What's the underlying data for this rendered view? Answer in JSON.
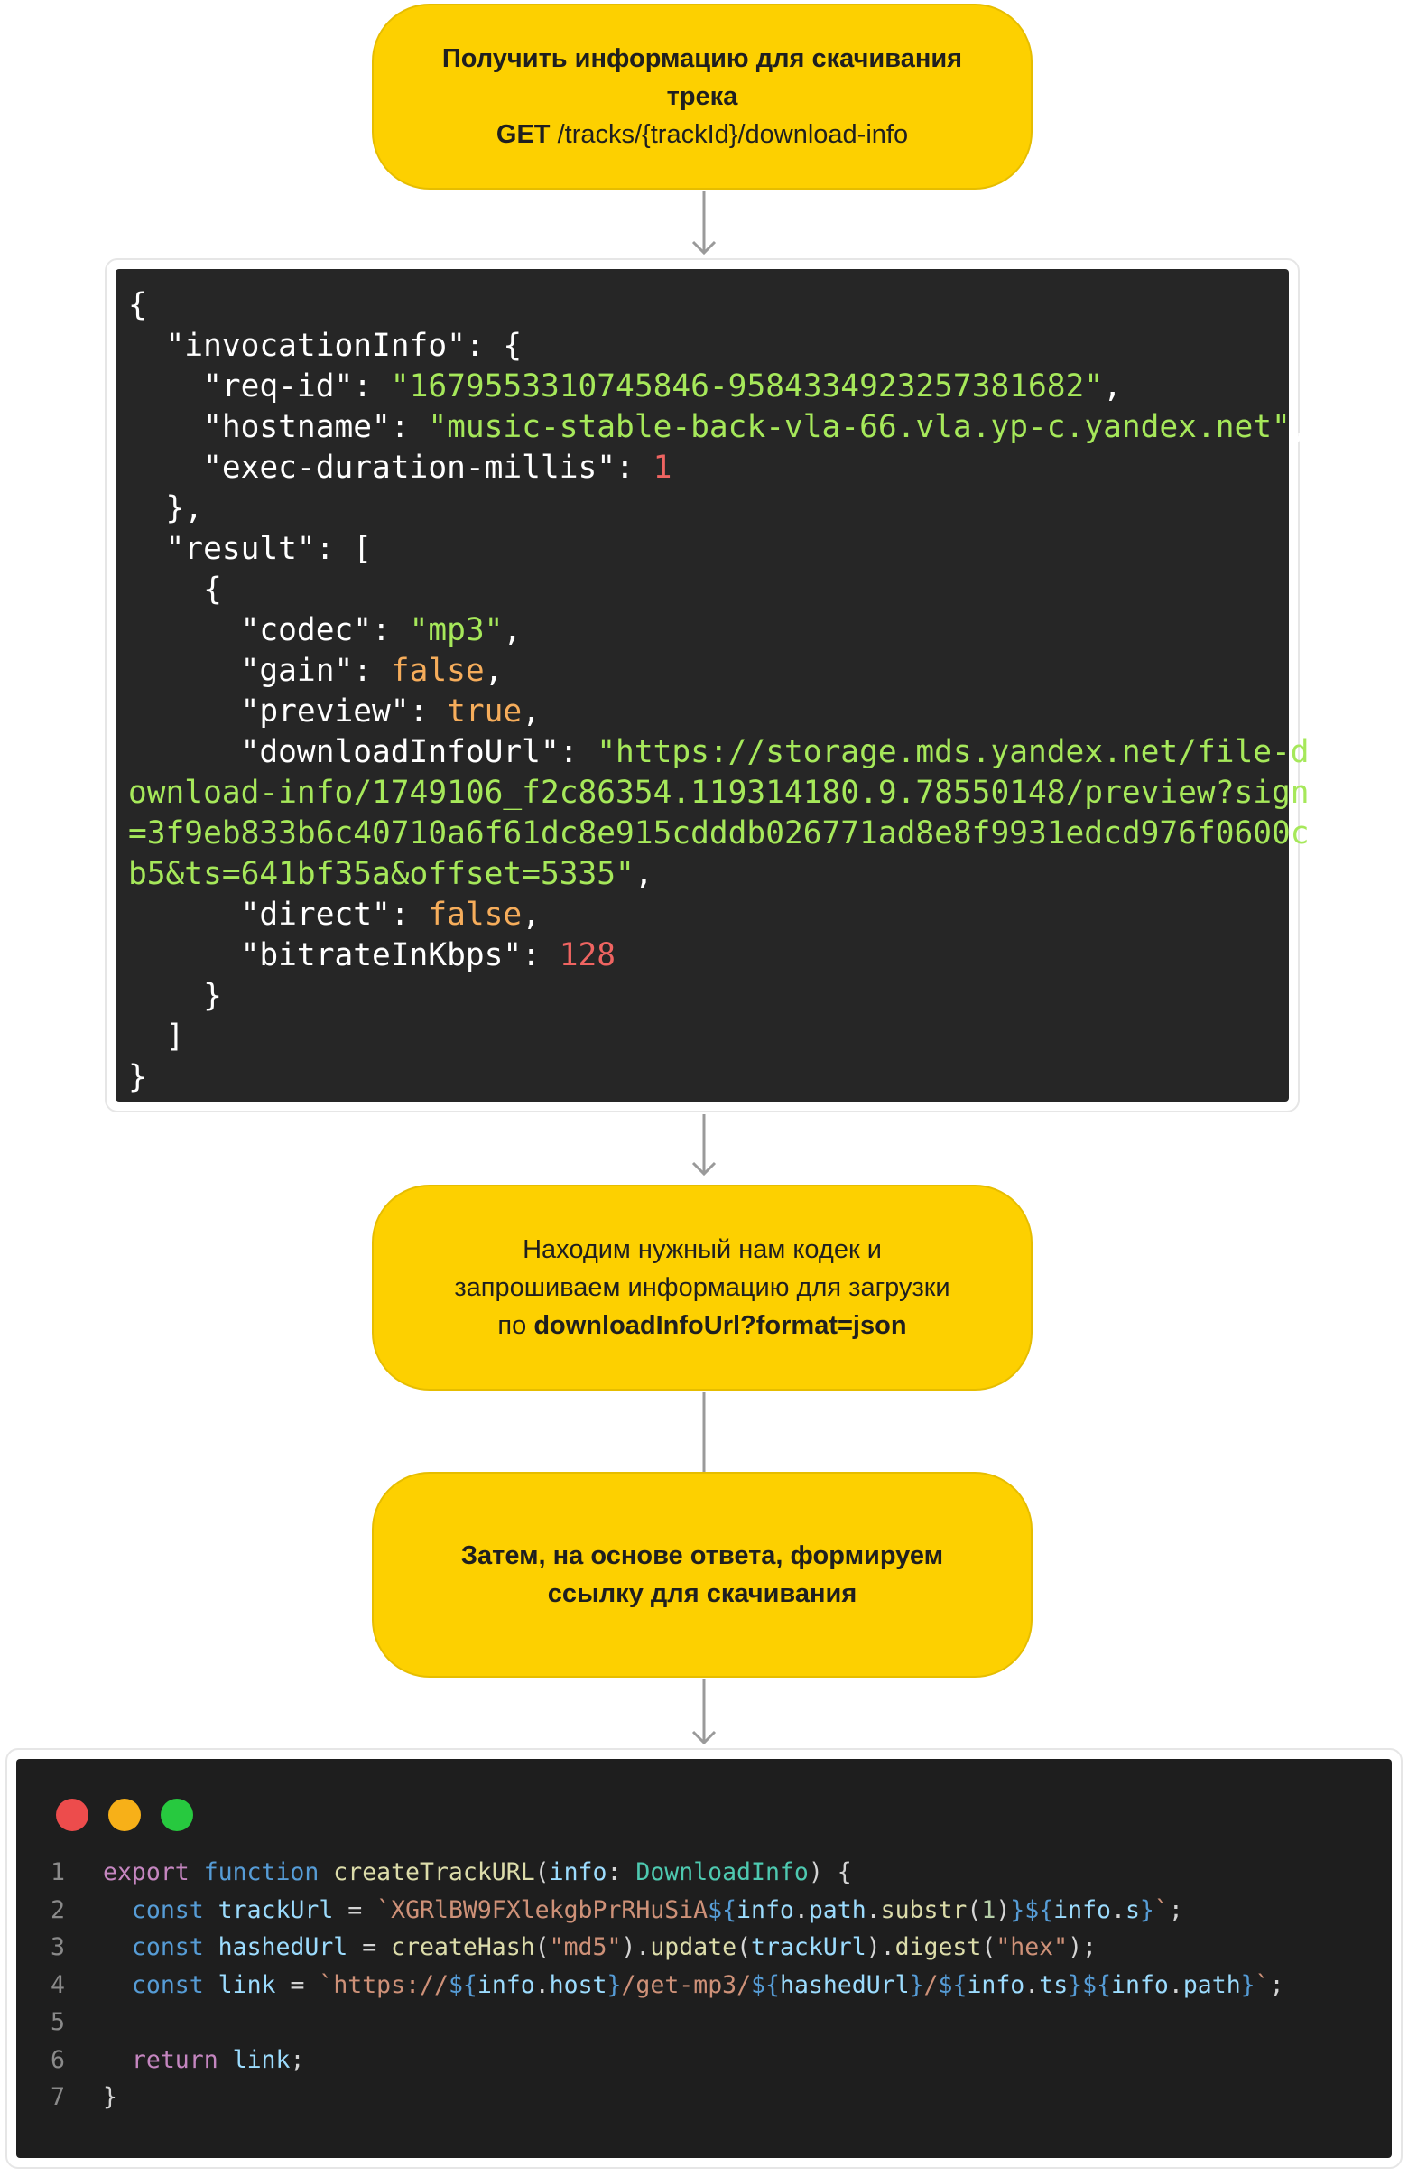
{
  "node1": {
    "line1": "Получить информацию для скачивания",
    "line2": "трека",
    "method": "GET",
    "path": " /tracks/{trackId}/download-info"
  },
  "json_response": {
    "lines": [
      [
        [
          "k",
          "{"
        ]
      ],
      [
        [
          "k",
          "  \"invocationInfo\": {"
        ]
      ],
      [
        [
          "k",
          "    \"req-id\": "
        ],
        [
          "s",
          "\"1679553310745846-958433492325738168​2\""
        ],
        [
          "k",
          ","
        ]
      ],
      [
        [
          "k",
          "    \"hostname\": "
        ],
        [
          "s",
          "\"music-stable-back-vla-66.vla.yp-c.yandex.net\""
        ],
        [
          "k",
          ","
        ]
      ],
      [
        [
          "k",
          "    \"exec-duration-millis\": "
        ],
        [
          "n",
          "1"
        ]
      ],
      [
        [
          "k",
          "  },"
        ]
      ],
      [
        [
          "k",
          "  \"result\": ["
        ]
      ],
      [
        [
          "k",
          "    {"
        ]
      ],
      [
        [
          "k",
          "      \"codec\": "
        ],
        [
          "s",
          "\"mp3\""
        ],
        [
          "k",
          ","
        ]
      ],
      [
        [
          "k",
          "      \"gain\": "
        ],
        [
          "bo",
          "false"
        ],
        [
          "k",
          ","
        ]
      ],
      [
        [
          "k",
          "      \"preview\": "
        ],
        [
          "bo",
          "true"
        ],
        [
          "k",
          ","
        ]
      ],
      [
        [
          "k",
          "      \"downloadInfoUrl\": "
        ],
        [
          "s",
          "\"https://storage.mds.yandex.net/file-d"
        ]
      ],
      [
        [
          "s",
          "ownload-info/1749106_f2c86354.119314180.9.78550148/preview?sign"
        ]
      ],
      [
        [
          "s",
          "=3f9eb833b6c40710a6f61dc8e915cdddb026771ad8e8f9931edcd976f0600c"
        ]
      ],
      [
        [
          "s",
          "b5&ts=641bf35a&offset=5335\""
        ],
        [
          "k",
          ","
        ]
      ],
      [
        [
          "k",
          "      \"direct\": "
        ],
        [
          "bo",
          "false"
        ],
        [
          "k",
          ","
        ]
      ],
      [
        [
          "k",
          "      \"bitrateInKbps\": "
        ],
        [
          "n",
          "128"
        ]
      ],
      [
        [
          "k",
          "    }"
        ]
      ],
      [
        [
          "k",
          "  ]"
        ]
      ],
      [
        [
          "k",
          "}"
        ]
      ]
    ]
  },
  "node2": {
    "line1": "Находим нужный нам кодек и",
    "line2": "запрошиваем информацию для загрузки",
    "prefix": "по ",
    "bold": "downloadInfoUrl?format=json"
  },
  "node3": {
    "line1": "Затем, на основе ответа, формируем",
    "line2": "ссылку для скачивания"
  },
  "editor": {
    "dots": [
      "#ed4c4c",
      "#f7b018",
      "#27c93f"
    ],
    "lines": [
      {
        "no": "1",
        "tokens": [
          [
            "kw2",
            "export "
          ],
          [
            "kw",
            "function "
          ],
          [
            "fn",
            "createTrackURL"
          ],
          [
            "pl",
            "("
          ],
          [
            "var",
            "info"
          ],
          [
            "pl",
            ": "
          ],
          [
            "ty",
            "DownloadInfo"
          ],
          [
            "pl",
            ") {"
          ]
        ]
      },
      {
        "no": "2",
        "tokens": [
          [
            "pl",
            "  "
          ],
          [
            "kw",
            "const "
          ],
          [
            "var",
            "trackUrl"
          ],
          [
            "pl",
            " = "
          ],
          [
            "str",
            "`XGRlBW9FXlekgbPrRHuSiA"
          ],
          [
            "kw",
            "${"
          ],
          [
            "var",
            "info"
          ],
          [
            "pl",
            "."
          ],
          [
            "var",
            "path"
          ],
          [
            "pl",
            "."
          ],
          [
            "fn",
            "substr"
          ],
          [
            "pl",
            "("
          ],
          [
            "num",
            "1"
          ],
          [
            "pl",
            ")"
          ],
          [
            "kw",
            "}${"
          ],
          [
            "var",
            "info"
          ],
          [
            "pl",
            "."
          ],
          [
            "var",
            "s"
          ],
          [
            "kw",
            "}"
          ],
          [
            "str",
            "`"
          ],
          [
            "pl",
            ";"
          ]
        ]
      },
      {
        "no": "3",
        "tokens": [
          [
            "pl",
            "  "
          ],
          [
            "kw",
            "const "
          ],
          [
            "var",
            "hashedUrl"
          ],
          [
            "pl",
            " = "
          ],
          [
            "fn",
            "createHash"
          ],
          [
            "pl",
            "("
          ],
          [
            "str",
            "\"md5\""
          ],
          [
            "pl",
            ")."
          ],
          [
            "fn",
            "update"
          ],
          [
            "pl",
            "("
          ],
          [
            "var",
            "trackUrl"
          ],
          [
            "pl",
            ")."
          ],
          [
            "fn",
            "digest"
          ],
          [
            "pl",
            "("
          ],
          [
            "str",
            "\"hex\""
          ],
          [
            "pl",
            ");"
          ]
        ]
      },
      {
        "no": "4",
        "tokens": [
          [
            "pl",
            "  "
          ],
          [
            "kw",
            "const "
          ],
          [
            "var",
            "link"
          ],
          [
            "pl",
            " = "
          ],
          [
            "str",
            "`https://"
          ],
          [
            "kw",
            "${"
          ],
          [
            "var",
            "info"
          ],
          [
            "pl",
            "."
          ],
          [
            "var",
            "host"
          ],
          [
            "kw",
            "}"
          ],
          [
            "str",
            "/get-mp3/"
          ],
          [
            "kw",
            "${"
          ],
          [
            "var",
            "hashedUrl"
          ],
          [
            "kw",
            "}"
          ],
          [
            "str",
            "/"
          ],
          [
            "kw",
            "${"
          ],
          [
            "var",
            "info"
          ],
          [
            "pl",
            "."
          ],
          [
            "var",
            "ts"
          ],
          [
            "kw",
            "}${"
          ],
          [
            "var",
            "info"
          ],
          [
            "pl",
            "."
          ],
          [
            "var",
            "path"
          ],
          [
            "kw",
            "}"
          ],
          [
            "str",
            "`"
          ],
          [
            "pl",
            ";"
          ]
        ]
      },
      {
        "no": "5",
        "tokens": []
      },
      {
        "no": "6",
        "tokens": [
          [
            "pl",
            "  "
          ],
          [
            "kw2",
            "return "
          ],
          [
            "var",
            "link"
          ],
          [
            "pl",
            ";"
          ]
        ]
      },
      {
        "no": "7",
        "tokens": [
          [
            "pl",
            "}"
          ]
        ]
      }
    ]
  }
}
